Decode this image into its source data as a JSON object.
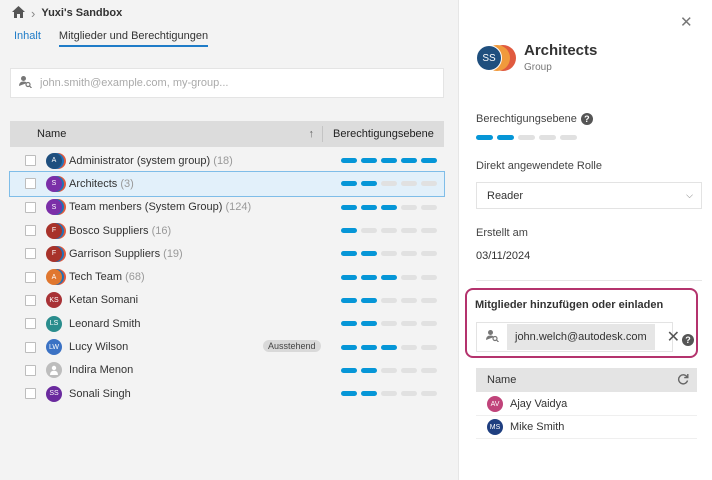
{
  "breadcrumb": {
    "home_icon": "home-icon",
    "title": "Yuxi's Sandbox"
  },
  "tabs": [
    {
      "label": "Inhalt",
      "active": false
    },
    {
      "label": "Mitglieder und Berechtigungen",
      "active": true
    }
  ],
  "search": {
    "placeholder": "john.smith@example.com, my-group..."
  },
  "table": {
    "col_name": "Name",
    "col_perm": "Berechtigungsebene",
    "rows": [
      {
        "name": "Administrator (system group)",
        "count": "(18)",
        "type": "group",
        "initials": "A",
        "color": "#1f4f7e",
        "level": 5,
        "selected": false,
        "badge": ""
      },
      {
        "name": "Architects",
        "count": "(3)",
        "type": "group",
        "initials": "S",
        "color": "#7b2fa8",
        "level": 2,
        "selected": true,
        "badge": ""
      },
      {
        "name": "Team menbers (System Group)",
        "count": "(124)",
        "type": "group",
        "initials": "S",
        "color": "#7b2fa8",
        "level": 3,
        "selected": false,
        "badge": ""
      },
      {
        "name": "Bosco Suppliers",
        "count": "(16)",
        "type": "group",
        "initials": "F",
        "color": "#a8322a",
        "level": 1,
        "selected": false,
        "badge": ""
      },
      {
        "name": "Garrison Suppliers",
        "count": "(19)",
        "type": "group",
        "initials": "F",
        "color": "#a8322a",
        "level": 2,
        "selected": false,
        "badge": ""
      },
      {
        "name": "Tech Team",
        "count": "(68)",
        "type": "group",
        "initials": "A",
        "color": "#e0772f",
        "level": 3,
        "selected": false,
        "badge": ""
      },
      {
        "name": "Ketan Somani",
        "count": "",
        "type": "user",
        "initials": "KS",
        "color": "#a83236",
        "level": 2,
        "selected": false,
        "badge": ""
      },
      {
        "name": "Leonard Smith",
        "count": "",
        "type": "user",
        "initials": "LS",
        "color": "#2a8d8d",
        "level": 2,
        "selected": false,
        "badge": ""
      },
      {
        "name": "Lucy Wilson",
        "count": "",
        "type": "user",
        "initials": "LW",
        "color": "#3b72c4",
        "level": 3,
        "selected": false,
        "badge": "Ausstehend"
      },
      {
        "name": "Indira Menon",
        "count": "",
        "type": "user",
        "initials": "",
        "color": "#bdbdbd",
        "level": 2,
        "selected": false,
        "badge": ""
      },
      {
        "name": "Sonali Singh",
        "count": "",
        "type": "user",
        "initials": "SS",
        "color": "#6a2a9e",
        "level": 2,
        "selected": false,
        "badge": ""
      }
    ]
  },
  "panel": {
    "avatar_initials": "SS",
    "title": "Architects",
    "subtitle": "Group",
    "perm_label": "Berechtigungsebene",
    "perm_level": 2,
    "role_label": "Direkt angewendete Rolle",
    "role_value": "Reader",
    "created_label": "Erstellt am",
    "created_value": "03/11/2024",
    "invite_title": "Mitglieder hinzufügen oder einladen",
    "invite_chip": "john.welch@autodesk.com",
    "members_header": "Name",
    "members": [
      {
        "name": "Ajay Vaidya",
        "initials": "AV",
        "color": "#c0437a"
      },
      {
        "name": "Mike Smith",
        "initials": "MS",
        "color": "#1f3f80"
      }
    ]
  },
  "colors": {
    "accent": "#0696d7",
    "highlight": "#b4336d"
  }
}
